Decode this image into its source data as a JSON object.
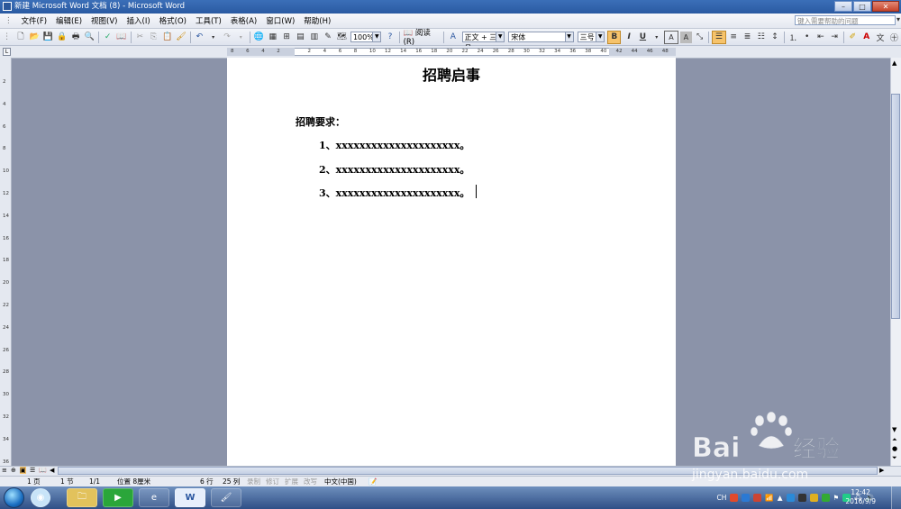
{
  "window": {
    "title": "新建 Microsoft Word 文档 (8) - Microsoft Word",
    "minimize": "–",
    "maximize": "□",
    "close": "✕"
  },
  "menu": {
    "items": [
      "文件(F)",
      "编辑(E)",
      "视图(V)",
      "插入(I)",
      "格式(O)",
      "工具(T)",
      "表格(A)",
      "窗口(W)",
      "帮助(H)"
    ],
    "help_placeholder": "键入需要帮助的问题"
  },
  "toolbar": {
    "zoom": "100%",
    "read_label": "阅读(R)",
    "style": "正文 + 三号",
    "font": "宋体",
    "size": "三号",
    "bold": "B",
    "italic": "I",
    "underline": "U",
    "charA": "A"
  },
  "ruler": {
    "numbers": [
      "8",
      "6",
      "4",
      "2",
      "",
      "2",
      "4",
      "6",
      "8",
      "10",
      "12",
      "14",
      "16",
      "18",
      "20",
      "22",
      "24",
      "26",
      "28",
      "30",
      "32",
      "34",
      "36",
      "38",
      "40",
      "42",
      "44",
      "46",
      "48"
    ],
    "vnumbers": [
      "2",
      "4",
      "6",
      "8",
      "10",
      "12",
      "14",
      "16",
      "18",
      "20",
      "22",
      "24",
      "26",
      "28",
      "30",
      "32",
      "34",
      "36"
    ]
  },
  "document": {
    "title": "招聘启事",
    "requirements_heading": "招聘要求：",
    "items": [
      "1、xxxxxxxxxxxxxxxxxxxxx。",
      "2、xxxxxxxxxxxxxxxxxxxxx。",
      "3、xxxxxxxxxxxxxxxxxxxxx。"
    ]
  },
  "status": {
    "page": "1 页",
    "section": "1 节",
    "pages": "1/1",
    "position": "位置 8厘米",
    "line": "6 行",
    "col": "25 列",
    "rec": "录制",
    "trk": "修订",
    "ext": "扩展",
    "ovr": "改写",
    "lang": "中文(中国)"
  },
  "taskbar": {
    "clock_time": "12:42",
    "clock_date": "2016/9/9",
    "lang": "CH"
  },
  "watermark": {
    "brand": "Bai",
    "brand2": "经验",
    "url": "jingyan.baidu.com"
  },
  "colors": {
    "titlebar": "#2a5aa2",
    "taskbar": "#2f4f86",
    "page_bg": "#8b93a9"
  }
}
